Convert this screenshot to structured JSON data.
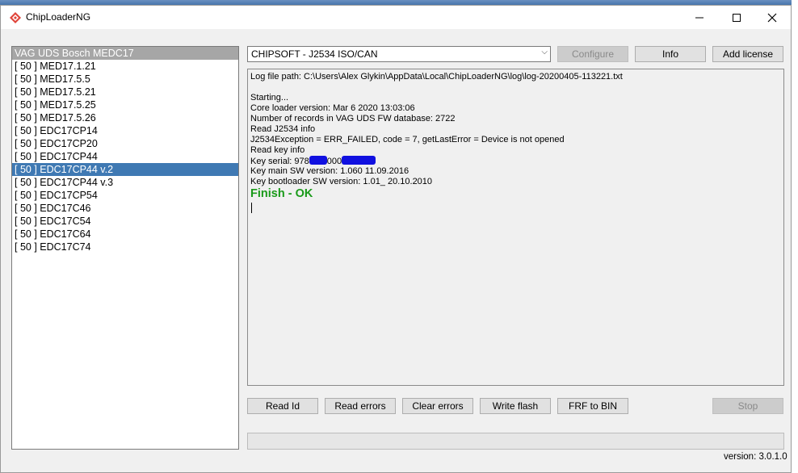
{
  "window": {
    "title": "ChipLoaderNG"
  },
  "protocols": {
    "header": "VAG UDS Bosch MEDC17",
    "items": [
      "[ 50 ] MED17.1.21",
      "[ 50 ] MED17.5.5",
      "[ 50 ] MED17.5.21",
      "[ 50 ] MED17.5.25",
      "[ 50 ] MED17.5.26",
      "[ 50 ] EDC17CP14",
      "[ 50 ] EDC17CP20",
      "[ 50 ] EDC17CP44",
      "[ 50 ] EDC17CP44 v.2",
      "[ 50 ] EDC17CP44 v.3",
      "[ 50 ] EDC17CP54",
      "[ 50 ] EDC17C46",
      "[ 50 ] EDC17C54",
      "[ 50 ] EDC17C64",
      "[ 50 ] EDC17C74"
    ],
    "selected_item": "[ 50 ] EDC17CP44 v.2"
  },
  "interface": {
    "selected": "CHIPSOFT - J2534 ISO/CAN"
  },
  "buttons": {
    "configure": "Configure",
    "info": "Info",
    "add_license": "Add license",
    "read_id": "Read Id",
    "read_errors": "Read errors",
    "clear_errors": "Clear errors",
    "write_flash": "Write flash",
    "frf_to_bin": "FRF to BIN",
    "stop": "Stop"
  },
  "log": {
    "path": "Log file path: C:\\Users\\Alex Glykin\\AppData\\Local\\ChipLoaderNG\\log\\log-20200405-113221.txt",
    "starting": "Starting...",
    "core_version": "Core loader version: Mar  6 2020 13:03:06",
    "records": "Number of records in VAG UDS FW database: 2722",
    "read_j2534": "Read J2534 info",
    "exception": "J2534Exception = ERR_FAILED, code = 7, getLastError = Device is not opened",
    "read_key": "Read key info",
    "key_serial_prefix": "Key serial: 978",
    "key_serial_mid": "000",
    "key_main_sw": "Key main SW version: 1.060 11.09.2016",
    "key_boot_sw": "Key bootloader SW version: 1.01_ 20.10.2010",
    "finish": "Finish - OK"
  },
  "progress": {
    "value": 0
  },
  "status": {
    "version": "version: 3.0.1.0"
  },
  "colors": {
    "selection": "#3f79b3",
    "finish": "#1a9a1a",
    "redaction": "#1010e0"
  }
}
